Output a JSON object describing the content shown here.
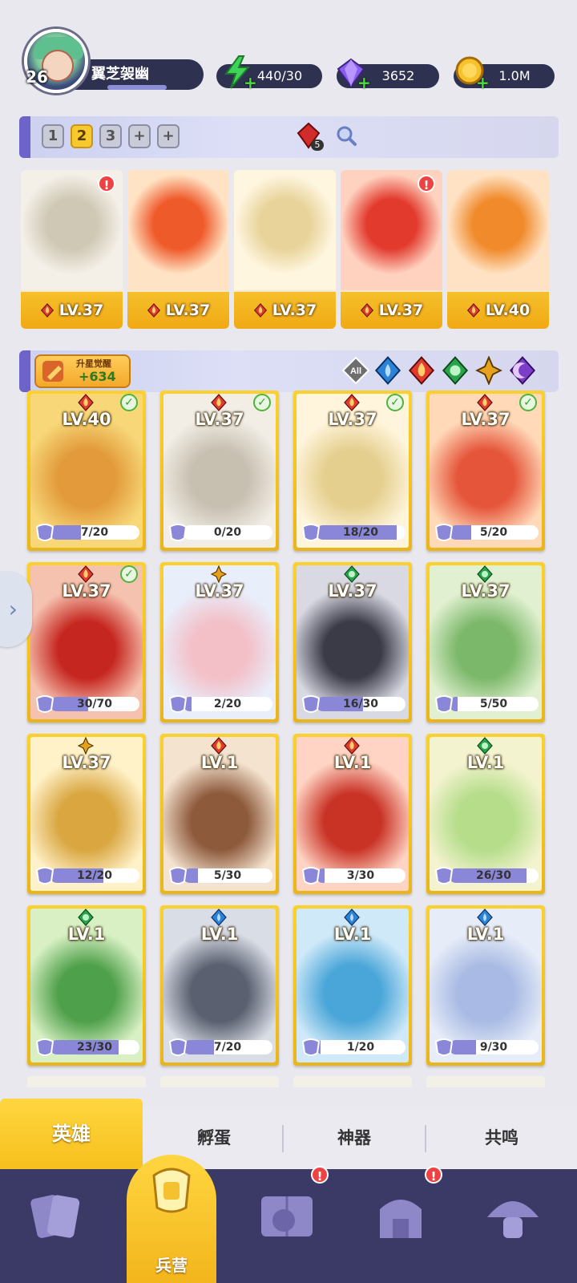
{
  "profile": {
    "level": "26",
    "name": "翼芝袈幽"
  },
  "resources": {
    "energy": "440/30",
    "gems": "3652",
    "coins": "1.0M"
  },
  "team_tabs": [
    "1",
    "2",
    "3",
    "+",
    "+"
  ],
  "team_active_index": 1,
  "gem_count": "5",
  "team": [
    {
      "level": "LV.37",
      "element": "fire",
      "alert": true
    },
    {
      "level": "LV.37",
      "element": "fire",
      "alert": false
    },
    {
      "level": "LV.37",
      "element": "fire",
      "alert": false
    },
    {
      "level": "LV.37",
      "element": "fire",
      "alert": true
    },
    {
      "level": "LV.40",
      "element": "fire",
      "alert": false
    }
  ],
  "awaken": {
    "label": "升星觉醒",
    "value": "+634"
  },
  "filters": [
    "All",
    "water",
    "fire",
    "wind",
    "light",
    "dark"
  ],
  "heroes": [
    {
      "level": "LV.40",
      "element": "fire",
      "check": true,
      "shards": "7/20",
      "progress": 0.35
    },
    {
      "level": "LV.37",
      "element": "fire",
      "check": true,
      "shards": "0/20",
      "progress": 0
    },
    {
      "level": "LV.37",
      "element": "fire",
      "check": true,
      "shards": "18/20",
      "progress": 0.9
    },
    {
      "level": "LV.37",
      "element": "fire",
      "check": true,
      "shards": "5/20",
      "progress": 0.25
    },
    {
      "level": "LV.37",
      "element": "fire",
      "check": true,
      "shards": "30/70",
      "progress": 0.43
    },
    {
      "level": "LV.37",
      "element": "light",
      "check": false,
      "shards": "2/20",
      "progress": 0.1
    },
    {
      "level": "LV.37",
      "element": "wind",
      "check": false,
      "shards": "16/30",
      "progress": 0.53
    },
    {
      "level": "LV.37",
      "element": "wind",
      "check": false,
      "shards": "5/50",
      "progress": 0.1
    },
    {
      "level": "LV.37",
      "element": "light",
      "check": false,
      "shards": "12/20",
      "progress": 0.6
    },
    {
      "level": "LV.1",
      "element": "fire",
      "check": false,
      "shards": "5/30",
      "progress": 0.17
    },
    {
      "level": "LV.1",
      "element": "fire",
      "check": false,
      "shards": "3/30",
      "progress": 0.1
    },
    {
      "level": "LV.1",
      "element": "wind",
      "check": false,
      "shards": "26/30",
      "progress": 0.87
    },
    {
      "level": "LV.1",
      "element": "wind",
      "check": false,
      "shards": "23/30",
      "progress": 0.77
    },
    {
      "level": "LV.1",
      "element": "water",
      "check": false,
      "shards": "7/20",
      "progress": 0.35
    },
    {
      "level": "LV.1",
      "element": "water",
      "check": false,
      "shards": "1/20",
      "progress": 0.05
    },
    {
      "level": "LV.1",
      "element": "water",
      "check": false,
      "shards": "9/30",
      "progress": 0.3
    }
  ],
  "tabs": [
    "英雄",
    "孵蛋",
    "神器",
    "共鸣"
  ],
  "nav": {
    "active_label": "兵营",
    "items": [
      "cards-icon",
      "barracks-icon",
      "map-book-icon",
      "temple-icon",
      "mushroom-icon"
    ],
    "alerts": [
      false,
      false,
      true,
      true,
      false
    ]
  },
  "colors": {
    "gold": "#f6c01c",
    "nav_bg": "#3b3a66",
    "fire": "#e23b2e",
    "water": "#2a83d6",
    "wind": "#2aa44b",
    "light": "#e6a21c",
    "dark": "#7a3ec9"
  }
}
